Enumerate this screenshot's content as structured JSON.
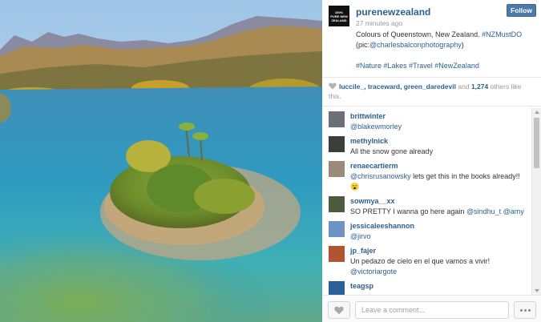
{
  "post": {
    "username": "purenewzealand",
    "avatar_text": "100% PURE NEW ZEALAND",
    "time_ago": "27 minutes ago",
    "follow_label": "Follow",
    "caption_text": "Colours of Queenstown, New Zealand.",
    "caption_tag": "#NZMustDO",
    "caption_pic_prefix": "(pic:",
    "caption_mention": "@charlesbalconphotography",
    "caption_pic_suffix": ")",
    "hashtags": [
      "#Nature",
      "#Lakes",
      "#Travel",
      "#NewZealand"
    ]
  },
  "likes": {
    "likers": "luccile_, traceward, green_daredevil",
    "and_text": "and",
    "count": "1,274",
    "suffix": "others like this."
  },
  "comments": [
    {
      "user": "brittwinter",
      "text": "",
      "mention": "@blakewmorley",
      "avatar_color": "#6a6f78"
    },
    {
      "user": "methylnick",
      "text": "All the snow gone already",
      "mention": "",
      "avatar_color": "#3a3f38"
    },
    {
      "user": "renaecartierm",
      "text": "",
      "mention": "@chrisrusanowsky",
      "text_after": "lets get this in the books already!! 😮",
      "avatar_color": "#9c8a7a"
    },
    {
      "user": "sowmya__xx",
      "text": "SO PRETTY I wanna go here again",
      "mention": "@sindhu_t",
      "mention2": "@amy",
      "avatar_color": "#4c5a3e"
    },
    {
      "user": "jessicaleeshannon",
      "text": "",
      "mention": "@jirvo",
      "avatar_color": "#6f93c4"
    },
    {
      "user": "jp_fajer",
      "text": "Un pedazo de cielo en el que vamos a vivir!",
      "mention": "@victoriargote",
      "avatar_color": "#b0552f"
    },
    {
      "user": "teagsp",
      "text": "",
      "mention": "",
      "avatar_color": "#2a5f9a"
    }
  ],
  "footer": {
    "comment_placeholder": "Leave a comment..."
  },
  "icons": {
    "like": "heart-icon",
    "more": "ellipsis-icon"
  },
  "colors": {
    "link": "#2d5f8f",
    "follow_button": "#4a7aa8"
  }
}
